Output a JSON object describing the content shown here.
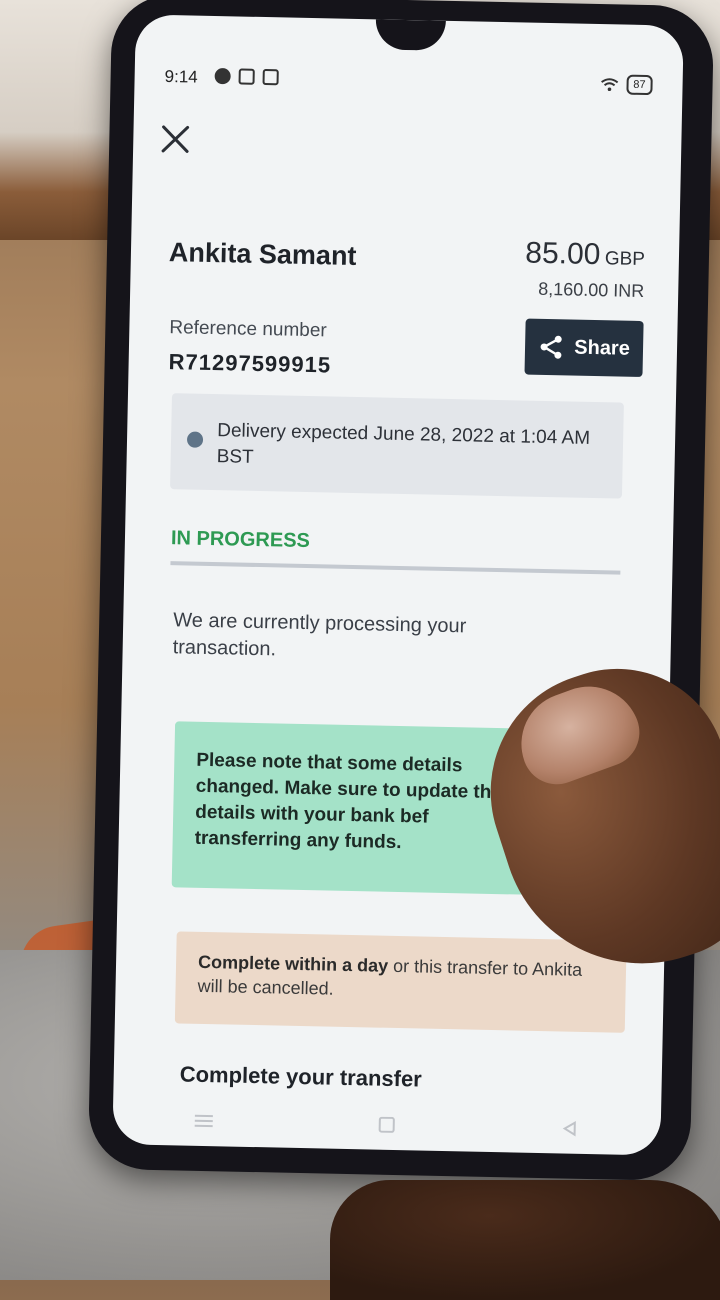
{
  "status_bar": {
    "time": "9:14",
    "battery": "87"
  },
  "header": {
    "close_label": "close"
  },
  "recipient": {
    "name": "Ankita Samant",
    "amount": "85.00",
    "currency": "GBP",
    "converted": "8,160.00 INR"
  },
  "reference": {
    "label": "Reference number",
    "value": "R71297599915"
  },
  "share": {
    "label": "Share"
  },
  "delivery": {
    "text": "Delivery expected June 28, 2022 at 1:04 AM BST"
  },
  "progress": {
    "status": "IN PROGRESS"
  },
  "processing": {
    "text": "We are currently processing your transaction."
  },
  "note": {
    "text": "Please note that some details changed. Make sure to update these details with your bank bef transferring any funds."
  },
  "warning": {
    "bold": "Complete within a day",
    "rest": " or this transfer to Ankita will be cancelled."
  },
  "complete": {
    "title": "Complete your transfer"
  },
  "colors": {
    "accent_green": "#2e9a53",
    "share_bg": "#25313f",
    "note_bg": "#a4e2c8",
    "warn_bg": "#ecd9c9"
  },
  "icons": [
    "facebook-icon",
    "shield-icon",
    "instagram-icon",
    "wifi-icon",
    "close-icon",
    "share-icon",
    "clock-icon"
  ]
}
